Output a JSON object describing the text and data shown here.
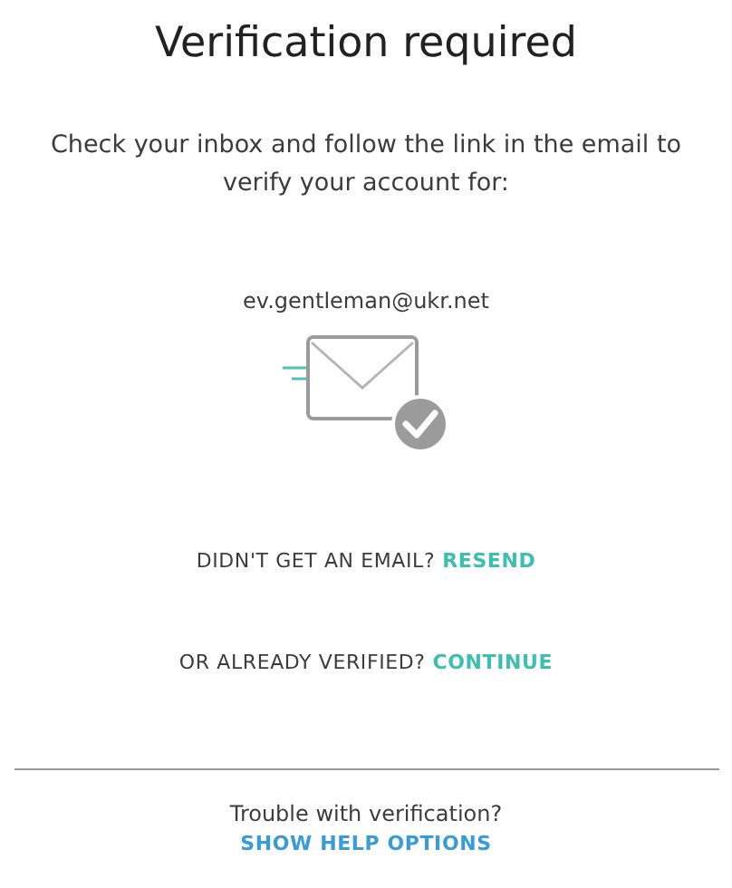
{
  "title": "Verification required",
  "message": "Check your inbox and follow the link in the email to verify your account for:",
  "email": "ev.gentleman@ukr.net",
  "resend": {
    "prompt": "DIDN'T GET AN EMAIL?",
    "link": "RESEND"
  },
  "continue": {
    "prompt": "OR ALREADY VERIFIED?",
    "link": "CONTINUE"
  },
  "help": {
    "prompt": "Trouble with verification?",
    "link": "SHOW HELP OPTIONS"
  }
}
